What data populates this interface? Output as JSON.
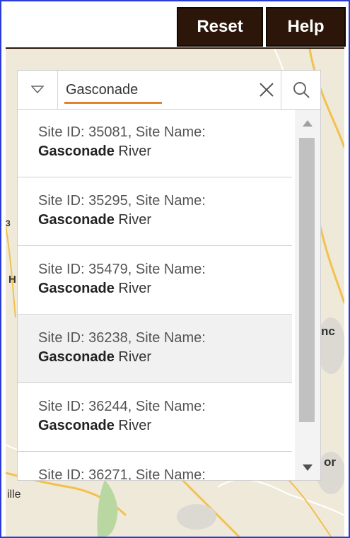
{
  "toolbar": {
    "reset_label": "Reset",
    "help_label": "Help"
  },
  "search": {
    "value": "Gasconade"
  },
  "results": [
    {
      "prefix": "Site ID: 35081, Site Name:",
      "match": "Gasconade",
      "rest": " River"
    },
    {
      "prefix": "Site ID: 35295, Site Name:",
      "match": "Gasconade",
      "rest": " River"
    },
    {
      "prefix": "Site ID: 35479, Site Name:",
      "match": "Gasconade",
      "rest": " River"
    },
    {
      "prefix": "Site ID: 36238, Site Name:",
      "match": "Gasconade",
      "rest": " River"
    },
    {
      "prefix": "Site ID: 36244, Site Name:",
      "match": "Gasconade",
      "rest": " River"
    },
    {
      "prefix": "Site ID: 36271, Site Name:",
      "match": "",
      "rest": ""
    }
  ],
  "map_labels": {
    "label_3": "3",
    "label_h": "H",
    "label_nc": "nc",
    "label_or": "or",
    "label_ille": "ille"
  },
  "colors": {
    "button_bg": "#2b1609",
    "border": "#2a3bd6",
    "underline": "#e5822e",
    "highlight_row": "#f1f1f1"
  },
  "icons": {
    "dropdown": "chevron-down-icon",
    "clear": "close-icon",
    "search": "search-icon",
    "scroll_up": "arrow-up-icon",
    "scroll_down": "arrow-down-icon"
  }
}
